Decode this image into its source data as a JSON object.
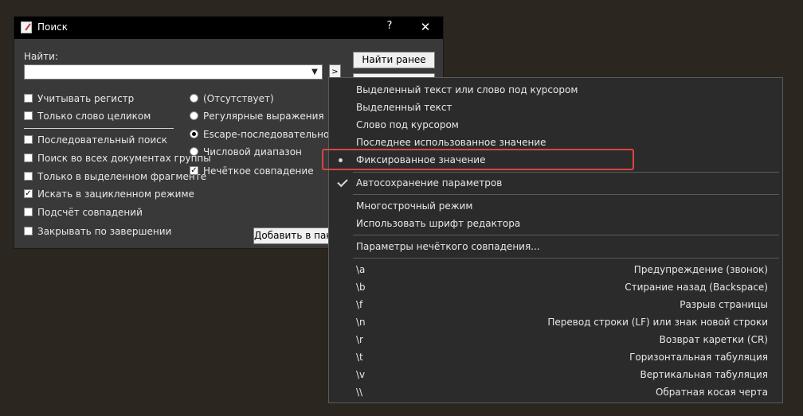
{
  "dialog": {
    "title": "Поиск",
    "help_label": "?",
    "close_label": "✕",
    "find_label": "Найти:",
    "find_value": "",
    "menu_button_label": ">",
    "find_prev_label": "Найти ранее",
    "add_to_batch_label": "Добавить в пакет",
    "checkboxes": [
      {
        "label": "Учитывать регистр",
        "checked": false
      },
      {
        "label": "Только слово целиком",
        "checked": false
      },
      {
        "label": "Последовательный поиск",
        "checked": false
      },
      {
        "label": "Поиск во всех документах группы",
        "checked": false
      },
      {
        "label": "Только в выделенном фрагменте",
        "checked": false
      },
      {
        "label": "Искать в зацикленном режиме",
        "checked": true
      },
      {
        "label": "Подсчёт совпадений",
        "checked": false
      },
      {
        "label": "Закрывать по завершении",
        "checked": false
      }
    ],
    "radios": [
      {
        "label": "(Отсутствует)",
        "checked": false
      },
      {
        "label": "Регулярные выражения",
        "checked": false
      },
      {
        "label": "Escape-последовательность",
        "checked": true
      },
      {
        "label": "Числовой диапазон",
        "checked": false
      }
    ],
    "fuzzy": {
      "label": "Нечёткое совпадение",
      "checked": true
    }
  },
  "context_menu": {
    "group1": [
      "Выделенный текст или слово под курсором",
      "Выделенный текст",
      "Слово под курсором",
      "Последнее использованное значение",
      "Фиксированное значение"
    ],
    "autosave": "Автосохранение параметров",
    "group3": [
      "Многострочный режим",
      "Использовать шрифт редактора"
    ],
    "fuzzy_params": "Параметры нечёткого совпадения...",
    "escapes": [
      {
        "code": "\\a",
        "desc": "Предупреждение (звонок)"
      },
      {
        "code": "\\b",
        "desc": "Стирание назад (Backspace)"
      },
      {
        "code": "\\f",
        "desc": "Разрыв страницы"
      },
      {
        "code": "\\n",
        "desc": "Перевод строки (LF) или знак новой строки"
      },
      {
        "code": "\\r",
        "desc": "Возврат каретки (CR)"
      },
      {
        "code": "\\t",
        "desc": "Горизонтальная табуляция"
      },
      {
        "code": "\\v",
        "desc": "Вертикальная табуляция"
      },
      {
        "code": "\\\\",
        "desc": "Обратная косая черта"
      }
    ]
  },
  "icons": {
    "combo_arrow": "chevron-down-icon",
    "selected_item": "bullet-icon",
    "checked_item": "check-icon"
  },
  "colors": {
    "highlight_box": "#d9463f",
    "titlebar": "#000000",
    "dialog_bg": "#393939",
    "menu_bg": "#2b2b2b"
  }
}
